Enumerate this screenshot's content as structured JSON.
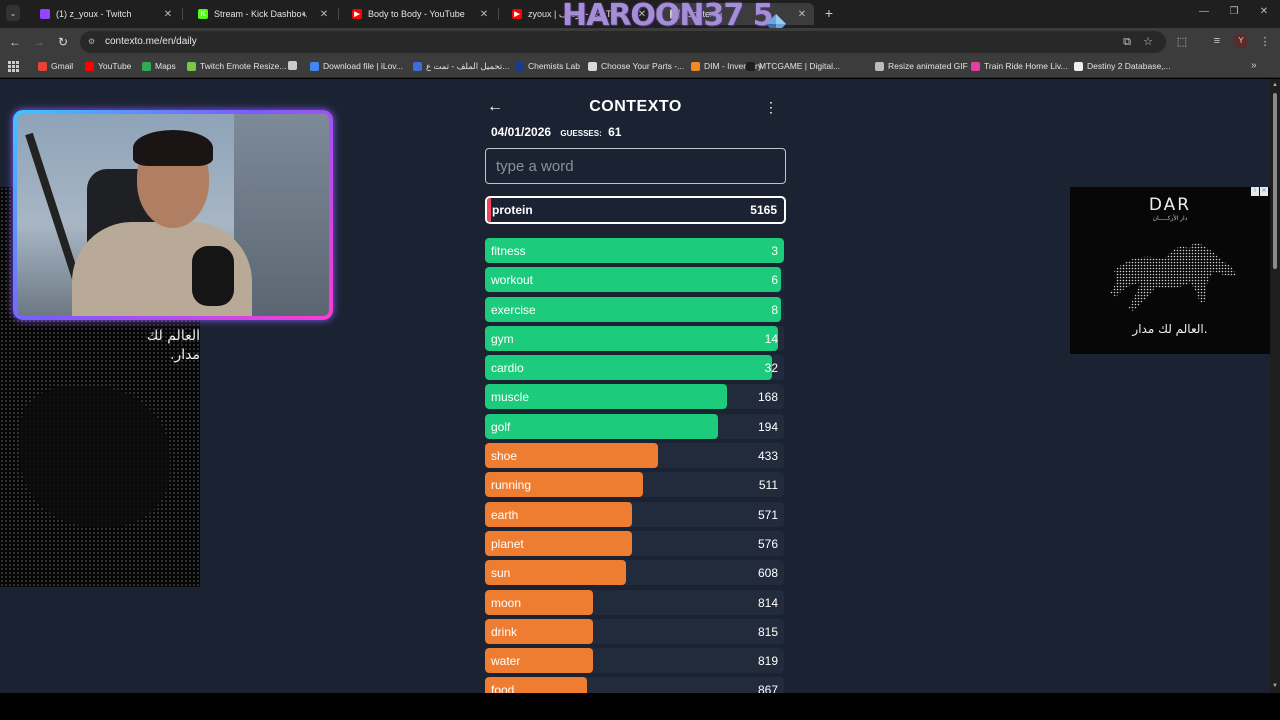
{
  "browser": {
    "tabs": [
      {
        "title": "(1) z_youx - Twitch",
        "icon": "twitch-icon",
        "color": "#9146ff",
        "glyph": ""
      },
      {
        "title": "Stream - Kick Dashboard",
        "icon": "kick-icon",
        "color": "#53fc18",
        "glyph": "K"
      },
      {
        "title": "Body to Body - YouTube",
        "icon": "youtube-icon",
        "color": "#ff0000",
        "glyph": "▶"
      },
      {
        "title": "zyoux | يوسف - YouTube",
        "icon": "youtube-icon",
        "color": "#ff0000",
        "glyph": "▶"
      },
      {
        "title": "Contexto",
        "icon": "contexto-icon",
        "color": "#d0d0d0",
        "glyph": ""
      }
    ],
    "url": "contexto.me/en/daily",
    "overlay_text": "HAROON37 5",
    "bookmarks": [
      {
        "label": "Gmail",
        "color": "#ea4335"
      },
      {
        "label": "YouTube",
        "color": "#ff0000"
      },
      {
        "label": "Maps",
        "color": "#34a853"
      },
      {
        "label": "Twitch Emote Resize...",
        "color": "#7ac943"
      },
      {
        "label": "",
        "color": "#cccccc"
      },
      {
        "label": "Download file | iLov...",
        "color": "#4285f4"
      },
      {
        "label": "تحميل الملف - تمت ع...",
        "color": "#3b6fd8"
      },
      {
        "label": "Chemists Lab",
        "color": "#1a3a8a"
      },
      {
        "label": "Choose Your Parts -...",
        "color": "#d9d9d9"
      },
      {
        "label": "DIM - Inventory",
        "color": "#f08a24"
      },
      {
        "label": "MTCGAME | Digital...",
        "color": "#1f1f1f"
      },
      {
        "label": "Resize animated GIF",
        "color": "#bbbbbb"
      },
      {
        "label": "Train Ride Home Liv...",
        "color": "#e040a0"
      },
      {
        "label": "Destiny 2 Database,...",
        "color": "#f0f0f0"
      }
    ]
  },
  "ads": {
    "left_text": "العالم لك مدار.",
    "right_logo": "DAR",
    "right_logo_sub": "دار الأركـــــان",
    "right_text": "العالم لك مدار."
  },
  "game": {
    "title": "CONTEXTO",
    "date": "04/01/2026",
    "guesses_label": "GUESSES:",
    "guesses": "61",
    "input_placeholder": "type a word",
    "current": {
      "word": "protein",
      "rank": "5165"
    },
    "colors": {
      "green": "#1dcb7c",
      "orange": "#ef7d31",
      "red": "#f2465f",
      "row_bg": "#222b3b"
    },
    "rows": [
      {
        "word": "fitness",
        "rank": "3",
        "fill": 1.0,
        "color": "green"
      },
      {
        "word": "workout",
        "rank": "6",
        "fill": 0.99,
        "color": "green"
      },
      {
        "word": "exercise",
        "rank": "8",
        "fill": 0.99,
        "color": "green"
      },
      {
        "word": "gym",
        "rank": "14",
        "fill": 0.98,
        "color": "green"
      },
      {
        "word": "cardio",
        "rank": "32",
        "fill": 0.96,
        "color": "green"
      },
      {
        "word": "muscle",
        "rank": "168",
        "fill": 0.81,
        "color": "green"
      },
      {
        "word": "golf",
        "rank": "194",
        "fill": 0.78,
        "color": "green"
      },
      {
        "word": "shoe",
        "rank": "433",
        "fill": 0.58,
        "color": "orange"
      },
      {
        "word": "running",
        "rank": "511",
        "fill": 0.53,
        "color": "orange"
      },
      {
        "word": "earth",
        "rank": "571",
        "fill": 0.49,
        "color": "orange"
      },
      {
        "word": "planet",
        "rank": "576",
        "fill": 0.49,
        "color": "orange"
      },
      {
        "word": "sun",
        "rank": "608",
        "fill": 0.47,
        "color": "orange"
      },
      {
        "word": "moon",
        "rank": "814",
        "fill": 0.36,
        "color": "orange"
      },
      {
        "word": "drink",
        "rank": "815",
        "fill": 0.36,
        "color": "orange"
      },
      {
        "word": "water",
        "rank": "819",
        "fill": 0.36,
        "color": "orange"
      },
      {
        "word": "food",
        "rank": "867",
        "fill": 0.34,
        "color": "orange"
      }
    ]
  }
}
